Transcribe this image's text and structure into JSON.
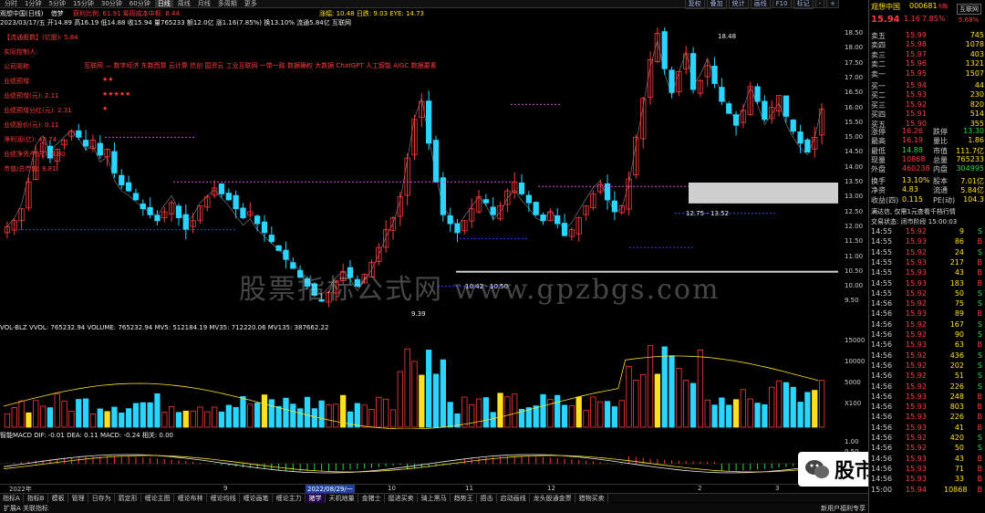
{
  "top_tabs": [
    "分时",
    "1分钟",
    "5分钟",
    "15分钟",
    "30分钟",
    "60分钟",
    "日线",
    "周线",
    "月线",
    "多周期",
    "更多"
  ],
  "top_tools": [
    "复权",
    "叠加",
    "统计",
    "画线",
    "F10",
    "标记",
    "-",
    "+"
  ],
  "title_line": {
    "name": "观想中国(日线)",
    "indicator": "借梦",
    "stats": "获利比例: 61.91  筹码成本中枢: 8.44",
    "r_label": "涨幅: 10.48  日跌: 9.03  EYE: 14.73"
  },
  "info_line": "2023/03/17/五 开14.89 高16.19 低14.88 收15.94 量765233 额12.0亿 涨1.16(7.85%) 换13.10% 流通5.84亿 互联网",
  "info_tag": "互联网",
  "left_labels": [
    {
      "text": "【流通股数】(亿股): 5.84",
      "color": "#ff3b3b"
    },
    {
      "text": "实际控制人:",
      "color": "#ff3b3b"
    },
    {
      "text": "公司简称:",
      "color": "#ff3b3b"
    },
    {
      "text": "业绩预增:",
      "color": "#ff3b3b"
    },
    {
      "text": "业绩预增(元): 2.11",
      "color": "#ff3b3b"
    },
    {
      "text": "业绩预增分红(元): 2.31",
      "color": "#ff3b3b"
    },
    {
      "text": "业绩股价(元): 0.11",
      "color": "#ff3b3b"
    },
    {
      "text": "净利润(亿): 48.74",
      "color": "#ff3b3b"
    },
    {
      "text": "业绩净资产(元): 4.80",
      "color": "#ff3b3b"
    },
    {
      "text": "市值/总市值: 8.81",
      "color": "#ff3b3b"
    }
  ],
  "concept_line": "互联网 — 数字经济 东数西算 云计算 信创 国资云 工业互联网 一带一路 数据确权 大数据 ChatGPT 人工智能 AIGC 数据要素",
  "star_rows": [
    "★★",
    "★★★★★",
    "★"
  ],
  "mid_labels": {
    "range1": "12.75 - 13.52",
    "range2": "10.42 - 10.50",
    "high": "18.48",
    "low": "9.39"
  },
  "main_y_ticks": [
    "18.50",
    "18.00",
    "17.50",
    "17.00",
    "16.50",
    "16.00",
    "15.50",
    "15.00",
    "14.50",
    "14.00",
    "13.50",
    "13.00",
    "12.50",
    "12.00",
    "11.50",
    "11.00",
    "10.50",
    "10.00",
    "9.50"
  ],
  "vol_header": "VOL-BLZ VVOL: 765232.94  VOLUME: 765232.94  MV5: 512184.19  MV35: 712220.06  MV135: 387662.22",
  "vol_y_ticks": [
    "15000",
    "10000",
    "5000",
    "X100"
  ],
  "macd_header": "智能MACD DIF: -0.01  DEA: 0.11  MACD: -0.24  相关: 0.00",
  "macd_y_ticks": [
    "1.00",
    "0.50",
    "0.00",
    "-0.50"
  ],
  "date_labels": [
    "2022年",
    "9",
    "2022/08/29/一",
    "10",
    "11",
    "12",
    "2",
    "3"
  ],
  "period_labels": [
    "筹",
    "涨",
    "涨",
    "B"
  ],
  "bottom_tabs": [
    "指标A",
    "指标B",
    "模板",
    "管理",
    "日存为",
    "箭定形",
    "缠论主图",
    "缠论布林",
    "缠论均线",
    "缠论画笔",
    "缠论主力",
    "赌学",
    "天机地量",
    "金猪士",
    "挺进买卖",
    "骑上黑马",
    "趋势王",
    "捂击",
    "启动画线",
    "龙头股通金票",
    "猎物买卖"
  ],
  "bottom_sub": "扩展A 关联指标",
  "bottom_sub_right": "新用户福利专享",
  "quote": {
    "name": "观想中国",
    "code": "000681",
    "badge": "R融",
    "price": "15.94",
    "change": "1.16",
    "pct": "7.85%",
    "btn": "互联网",
    "weibi": "5.68%",
    "sell": [
      {
        "l": "卖五",
        "p": "15.99",
        "v": "745"
      },
      {
        "l": "卖四",
        "p": "15.98",
        "v": "1078"
      },
      {
        "l": "卖三",
        "p": "15.97",
        "v": "403"
      },
      {
        "l": "卖二",
        "p": "15.96",
        "v": "1321"
      },
      {
        "l": "卖一",
        "p": "15.95",
        "v": "1507"
      }
    ],
    "buy": [
      {
        "l": "买一",
        "p": "15.94",
        "v": "44"
      },
      {
        "l": "买二",
        "p": "15.93",
        "v": "230"
      },
      {
        "l": "买三",
        "p": "15.92",
        "v": "820"
      },
      {
        "l": "买四",
        "p": "15.91",
        "v": "514"
      },
      {
        "l": "买五",
        "p": "15.90",
        "v": "355"
      }
    ],
    "stats": [
      {
        "a": "涨停",
        "b": "16.26",
        "c": "跌停",
        "d": "13.30"
      },
      {
        "a": "最高",
        "b": "16.19",
        "c": "量比",
        "d": "1.86"
      },
      {
        "a": "最低",
        "b": "14.88",
        "c": "市值",
        "d": "111.7亿"
      },
      {
        "a": "现量",
        "b": "10868",
        "c": "总量",
        "d": "765233"
      },
      {
        "a": "外盘",
        "b": "460238",
        "c": "内盘",
        "d": "304995"
      }
    ],
    "stats2": [
      {
        "a": "换手",
        "b": "13.10%",
        "c": "股本",
        "d": "7.01亿"
      },
      {
        "a": "净资",
        "b": "4.83",
        "c": "流通",
        "d": "5.84亿"
      },
      {
        "a": "收益(四)",
        "b": "0.115",
        "c": "PE(动)",
        "d": "104.3"
      }
    ],
    "msg1": "满达信, 仅需1元查看千档行情",
    "msg2": "交易状态: 闭市阶段 15:00:03",
    "ticks": [
      [
        "14:55",
        "15.92",
        "9",
        "S"
      ],
      [
        "14:55",
        "15.93",
        "86",
        "B"
      ],
      [
        "14:55",
        "15.92",
        "24",
        "S"
      ],
      [
        "14:55",
        "15.93",
        "217",
        "B"
      ],
      [
        "14:55",
        "15.93",
        "43",
        "B"
      ],
      [
        "14:55",
        "15.93",
        "183",
        "B"
      ],
      [
        "14:55",
        "15.92",
        "50",
        "S"
      ],
      [
        "14:56",
        "15.92",
        "75",
        "S"
      ],
      [
        "14:56",
        "15.93",
        "89",
        "B"
      ],
      [
        "14:56",
        "15.92",
        "167",
        "S"
      ],
      [
        "14:56",
        "15.92",
        "90",
        "S"
      ],
      [
        "14:56",
        "15.93",
        "63",
        "B"
      ],
      [
        "14:56",
        "15.92",
        "436",
        "S"
      ],
      [
        "14:56",
        "15.92",
        "202",
        "S"
      ],
      [
        "14:56",
        "15.92",
        "51",
        "S"
      ],
      [
        "14:56",
        "15.92",
        "226",
        "S"
      ],
      [
        "14:56",
        "15.93",
        "248",
        "B"
      ],
      [
        "14:56",
        "15.93",
        "803",
        "B"
      ],
      [
        "14:56",
        "15.93",
        "226",
        "B"
      ],
      [
        "14:56",
        "15.93",
        "41",
        "B"
      ],
      [
        "14:56",
        "15.92",
        "420",
        "S"
      ],
      [
        "14:56",
        "15.92",
        "50",
        "S"
      ],
      [
        "14:56",
        "15.93",
        "43",
        "B"
      ],
      [
        "14:56",
        "15.93",
        "71",
        "B"
      ],
      [
        "14:56",
        "15.93",
        "33",
        "B"
      ],
      [
        "15:00",
        "15.94",
        "10868",
        "B"
      ]
    ]
  },
  "wechat_text": "股市客栈",
  "watermark": "股票指标公式网 www.gpzbgs.com",
  "colors": {
    "up": "#ff3b3b",
    "down": "#2ad5ff",
    "yellow": "#ffe020",
    "green": "#2bd84a",
    "magenta": "#e040e0"
  }
}
